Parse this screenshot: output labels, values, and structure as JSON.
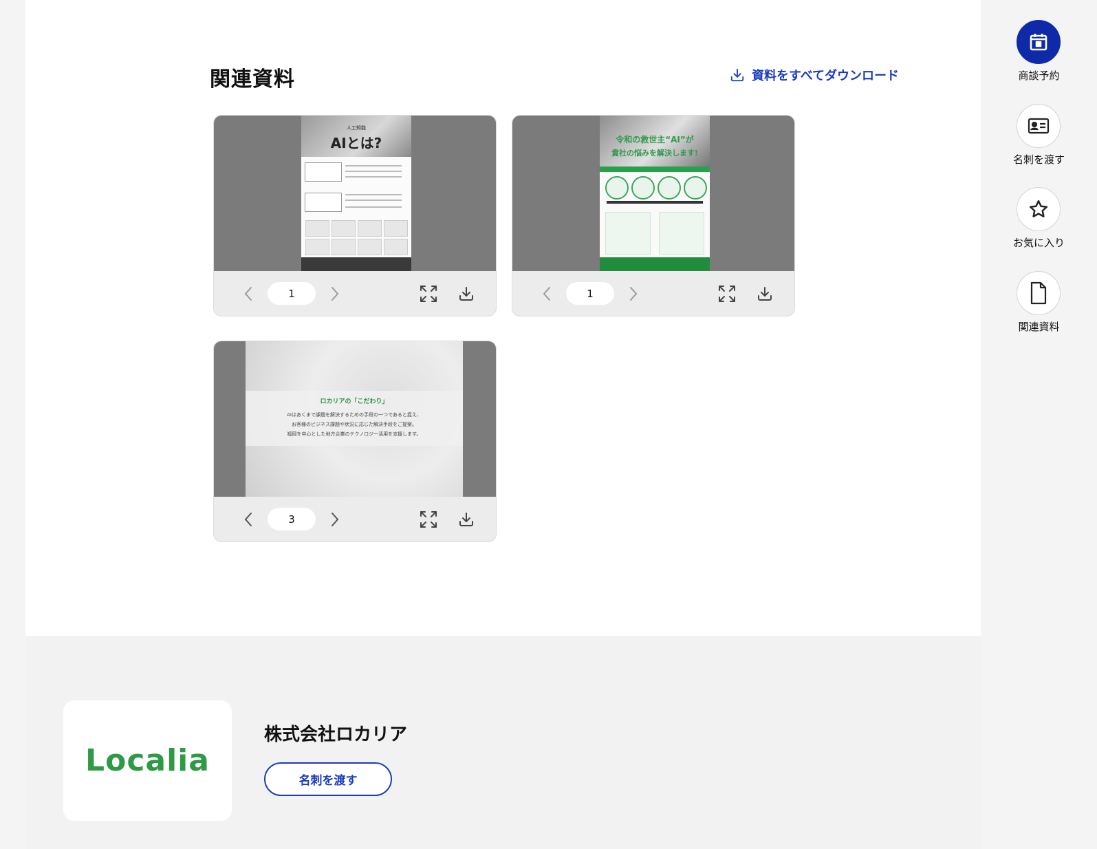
{
  "related": {
    "title": "関連資料",
    "download_all_label": "資料をすべてダウンロード",
    "documents": [
      {
        "page": "1",
        "preview": {
          "subtitle": "人工知能",
          "headline": "AIとは?"
        }
      },
      {
        "page": "1",
        "preview": {
          "headline_1": "令和の救世主“AI”が",
          "headline_2": "貴社の悩みを解決します!"
        }
      },
      {
        "page": "3",
        "preview": {
          "heading": "ロカリアの「こだわり」",
          "lines": [
            "AIはあくまで課題を解決するための手段の一つであると捉え、",
            "お客様のビジネス課題や状況に応じた解決手段をご提案。",
            "福岡を中心とした地方企業のテクノロジー活用を支援します。"
          ]
        }
      }
    ]
  },
  "company": {
    "logo_text": "Localia",
    "name": "株式会社ロカリア",
    "card_button_label": "名刺を渡す"
  },
  "rail": {
    "items": [
      {
        "label": "商談予約",
        "icon": "calendar-icon",
        "active": true
      },
      {
        "label": "名刺を渡す",
        "icon": "id-card-icon",
        "active": false
      },
      {
        "label": "お気に入り",
        "icon": "star-icon",
        "active": false
      },
      {
        "label": "関連資料",
        "icon": "document-icon",
        "active": false
      }
    ]
  },
  "colors": {
    "accent": "#1a3bc0",
    "rail_active": "#0f2aa8",
    "brand_green": "#2f9a45"
  }
}
